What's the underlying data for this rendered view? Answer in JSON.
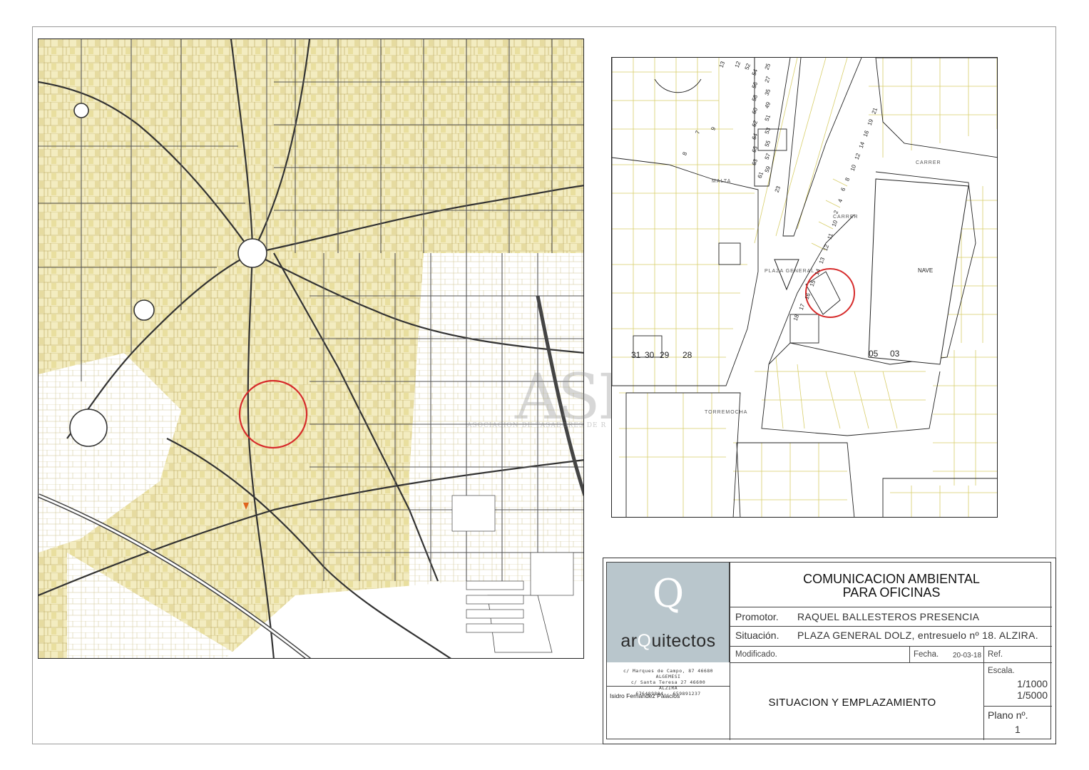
{
  "sheet": {
    "watermark": "ASR",
    "watermark_sub": "ASOCIACION DE TASADORES DE R"
  },
  "city_map": {
    "marker_color": "#d62b2b",
    "location_color": "#e0641e"
  },
  "detail_map": {
    "street_labels": [
      "CARRER",
      "MALTA",
      "TORREMOCHA",
      "CARRER",
      "PLAZA GENERAL"
    ],
    "parcel_numbers": [
      "31",
      "30",
      "29",
      "28",
      "05",
      "03"
    ],
    "building_label": "NAVE",
    "street_numbers": [
      "13",
      "12",
      "7",
      "8",
      "9",
      "18",
      "17",
      "16",
      "15",
      "14",
      "13",
      "12",
      "11",
      "10",
      "2",
      "4",
      "6",
      "8",
      "10",
      "12",
      "14",
      "16",
      "19",
      "21",
      "23",
      "25",
      "27",
      "35",
      "49",
      "51",
      "53",
      "55",
      "57",
      "59",
      "61",
      "63",
      "65",
      "64",
      "62",
      "60",
      "58",
      "56",
      "54",
      "52"
    ]
  },
  "title_block": {
    "logo_letter": "Q",
    "logo_word_pre": "ar",
    "logo_word_mid": "Q",
    "logo_word_post": "uitectos",
    "address_lines": [
      "c/ Marques de Campo, 87 46680",
      "ALGEMESI",
      "c/ Santa Teresa 27 46600",
      "ALZIRA",
      "676489804 - 659891237"
    ],
    "author": "Isidro Fernández Palacios",
    "project_title_1": "COMUNICACION AMBIENTAL",
    "project_title_2": "PARA OFICINAS",
    "promotor_label": "Promotor.",
    "promotor_value": "RAQUEL BALLESTEROS PRESENCIA",
    "situacion_label": "Situación.",
    "situacion_value": "PLAZA GENERAL DOLZ, entresuelo nº 18. ALZIRA.",
    "modificado_label": "Modificado.",
    "fecha_label": "Fecha.",
    "fecha_value": "20-03-18",
    "ref_label": "Ref.",
    "plan_name": "SITUACION Y EMPLAZAMIENTO",
    "escala_label": "Escala.",
    "escala_1": "1/1000",
    "escala_2": "1/5000",
    "plano_label": "Plano nº.",
    "plano_value": "1"
  }
}
